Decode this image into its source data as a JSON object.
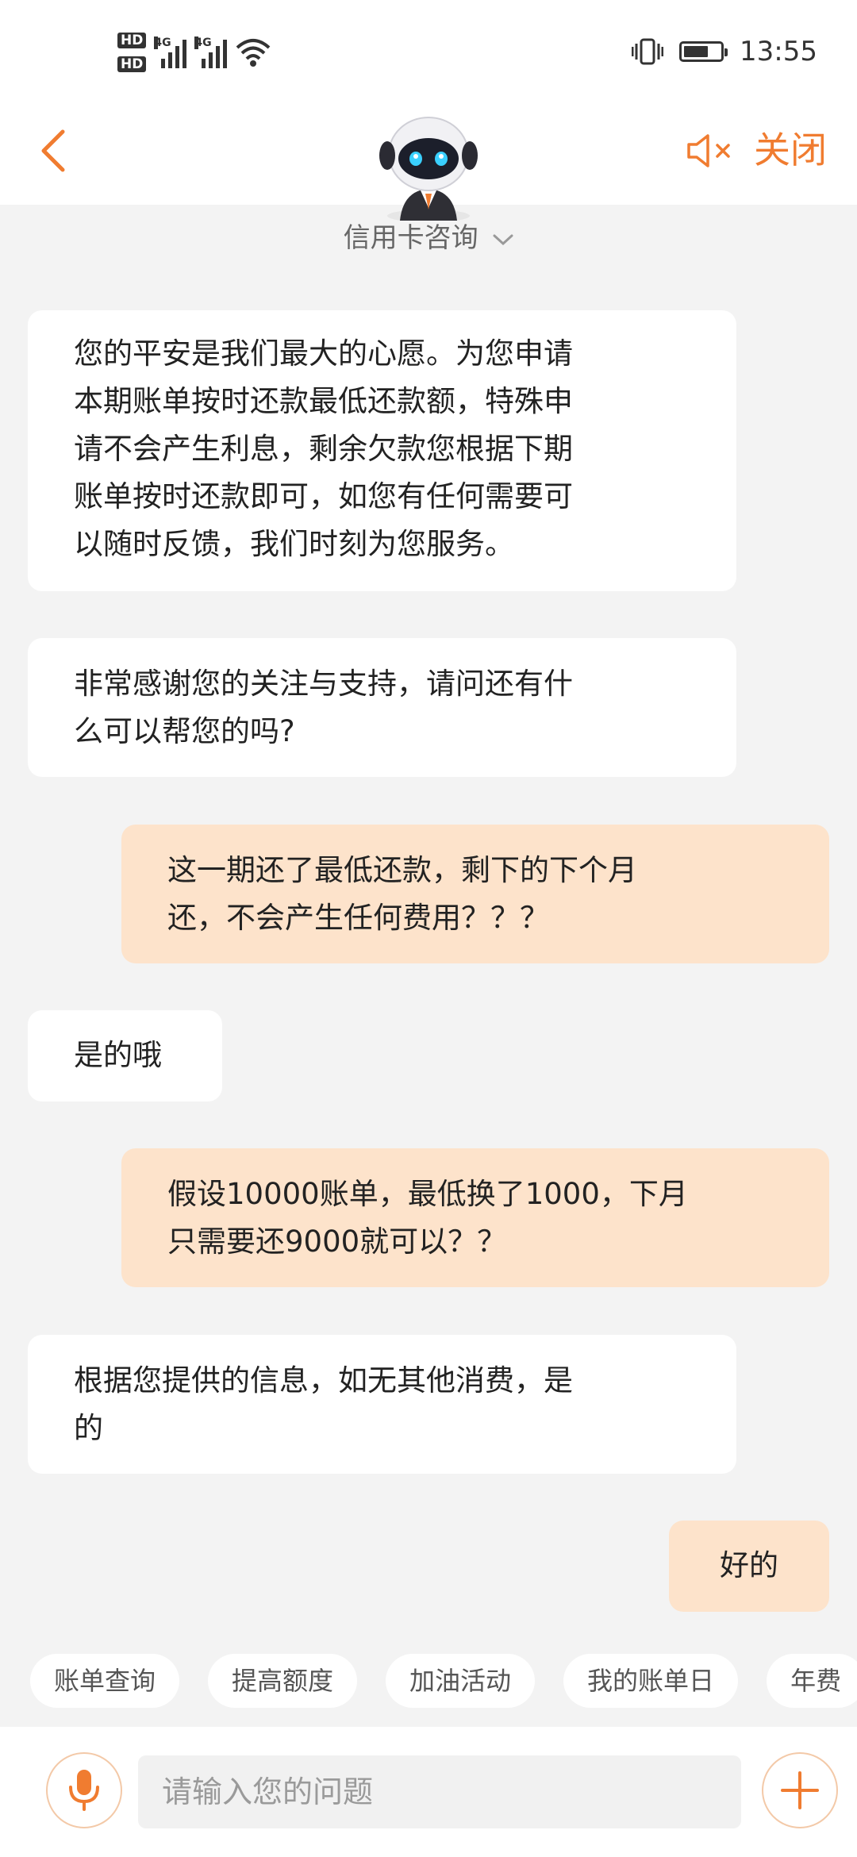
{
  "status_bar": {
    "time": "13:55",
    "sim1_label": "HD",
    "sim2_label": "HD",
    "net1": "4G",
    "net2": "4G",
    "icons": [
      "hd-sim1-icon",
      "hd-sim2-icon",
      "signal-4g-icon",
      "signal-4g-icon",
      "wifi-icon",
      "vibrate-icon",
      "battery-icon"
    ]
  },
  "header": {
    "back_icon": "chevron-left-icon",
    "mute_icon": "speaker-muted-icon",
    "close_label": "关闭",
    "avatar": "robot-assistant-avatar",
    "accent_color": "#f07c30"
  },
  "topic": {
    "label": "信用卡咨询",
    "icon": "chevron-down-icon"
  },
  "messages": [
    {
      "sender": "bot",
      "text": "您的平安是我们最大的心愿。为您申请\n本期账单按时还款最低还款额，特殊申\n请不会产生利息，剩余欠款您根据下期\n账单按时还款即可，如您有任何需要可\n以随时反馈，我们时刻为您服务。"
    },
    {
      "sender": "bot",
      "text": "非常感谢您的关注与支持，请问还有什\n么可以帮您的吗?"
    },
    {
      "sender": "user",
      "text": "这一期还了最低还款，剩下的下个月\n还，不会产生任何费用？？？"
    },
    {
      "sender": "bot",
      "text": "是的哦"
    },
    {
      "sender": "user",
      "text": "假设10000账单，最低换了1000，下月\n只需要还9000就可以？？"
    },
    {
      "sender": "bot",
      "text": "根据您提供的信息，如无其他消费，是\n的"
    },
    {
      "sender": "user",
      "text": "好的"
    }
  ],
  "quick_replies": [
    "账单查询",
    "提高额度",
    "加油活动",
    "我的账单日",
    "年费"
  ],
  "input": {
    "placeholder": "请输入您的问题",
    "value": "",
    "mic_icon": "microphone-icon",
    "plus_icon": "plus-icon"
  },
  "colors": {
    "user_bubble": "#fde3cb",
    "bot_bubble": "#ffffff",
    "background": "#f3f3f3"
  }
}
